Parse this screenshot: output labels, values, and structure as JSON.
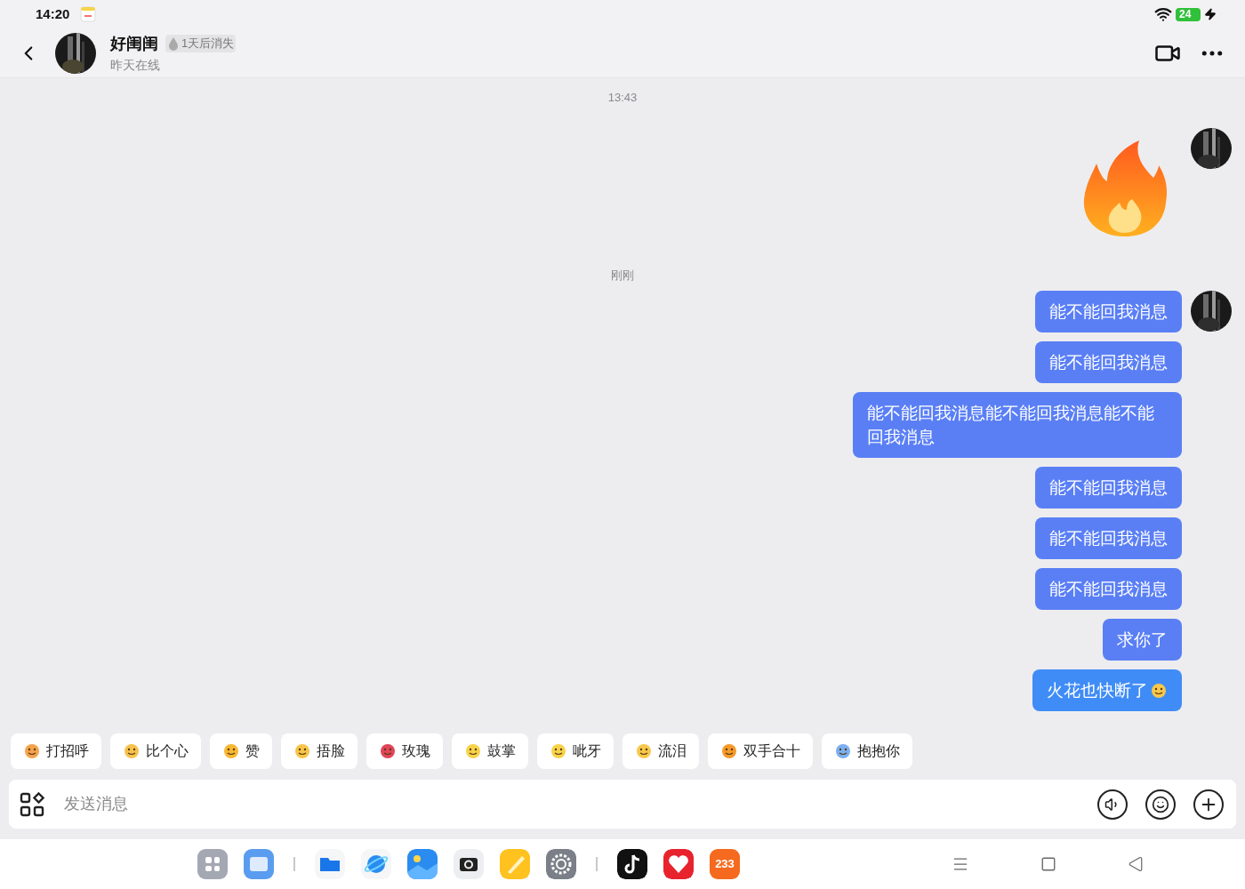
{
  "status_bar": {
    "time": "14:20",
    "battery": "24"
  },
  "header": {
    "name": "好闺闺",
    "badge": "1天后消失",
    "status": "昨天在线"
  },
  "messages": [
    {
      "kind": "timestamp",
      "text": "13:43"
    },
    {
      "kind": "sticker",
      "show_avatar": true
    },
    {
      "kind": "timestamp",
      "text": "刚刚"
    },
    {
      "kind": "text",
      "text": "能不能回我消息",
      "show_avatar": true,
      "color": "#5a7ff5"
    },
    {
      "kind": "text",
      "text": "能不能回我消息",
      "show_avatar": false,
      "color": "#5a7ff5"
    },
    {
      "kind": "text",
      "text": "能不能回我消息能不能回我消息能不能回我消息",
      "show_avatar": false,
      "color": "#5a7ff5"
    },
    {
      "kind": "text",
      "text": "能不能回我消息",
      "show_avatar": false,
      "color": "#5a7ff5"
    },
    {
      "kind": "text",
      "text": "能不能回我消息",
      "show_avatar": false,
      "color": "#5a7ff5"
    },
    {
      "kind": "text",
      "text": "能不能回我消息",
      "show_avatar": false,
      "color": "#5a7ff5"
    },
    {
      "kind": "text",
      "text": "求你了",
      "show_avatar": false,
      "color": "#5a7ff5"
    },
    {
      "kind": "text",
      "text": "火花也快断了",
      "show_avatar": false,
      "color": "#3f8cf7",
      "emoji": true
    }
  ],
  "quick_replies": [
    "打招呼",
    "比个心",
    "赞",
    "捂脸",
    "玫瑰",
    "鼓掌",
    "呲牙",
    "流泪",
    "双手合十",
    "抱抱你"
  ],
  "input": {
    "placeholder": "发送消息"
  },
  "dock": [
    {
      "kind": "apps"
    },
    {
      "kind": "calendar"
    },
    {
      "kind": "divider"
    },
    {
      "kind": "files"
    },
    {
      "kind": "browser"
    },
    {
      "kind": "gallery"
    },
    {
      "kind": "camera"
    },
    {
      "kind": "notes"
    },
    {
      "kind": "settings"
    },
    {
      "kind": "divider"
    },
    {
      "kind": "video"
    },
    {
      "kind": "shop"
    },
    {
      "kind": "game",
      "text": "233"
    }
  ]
}
